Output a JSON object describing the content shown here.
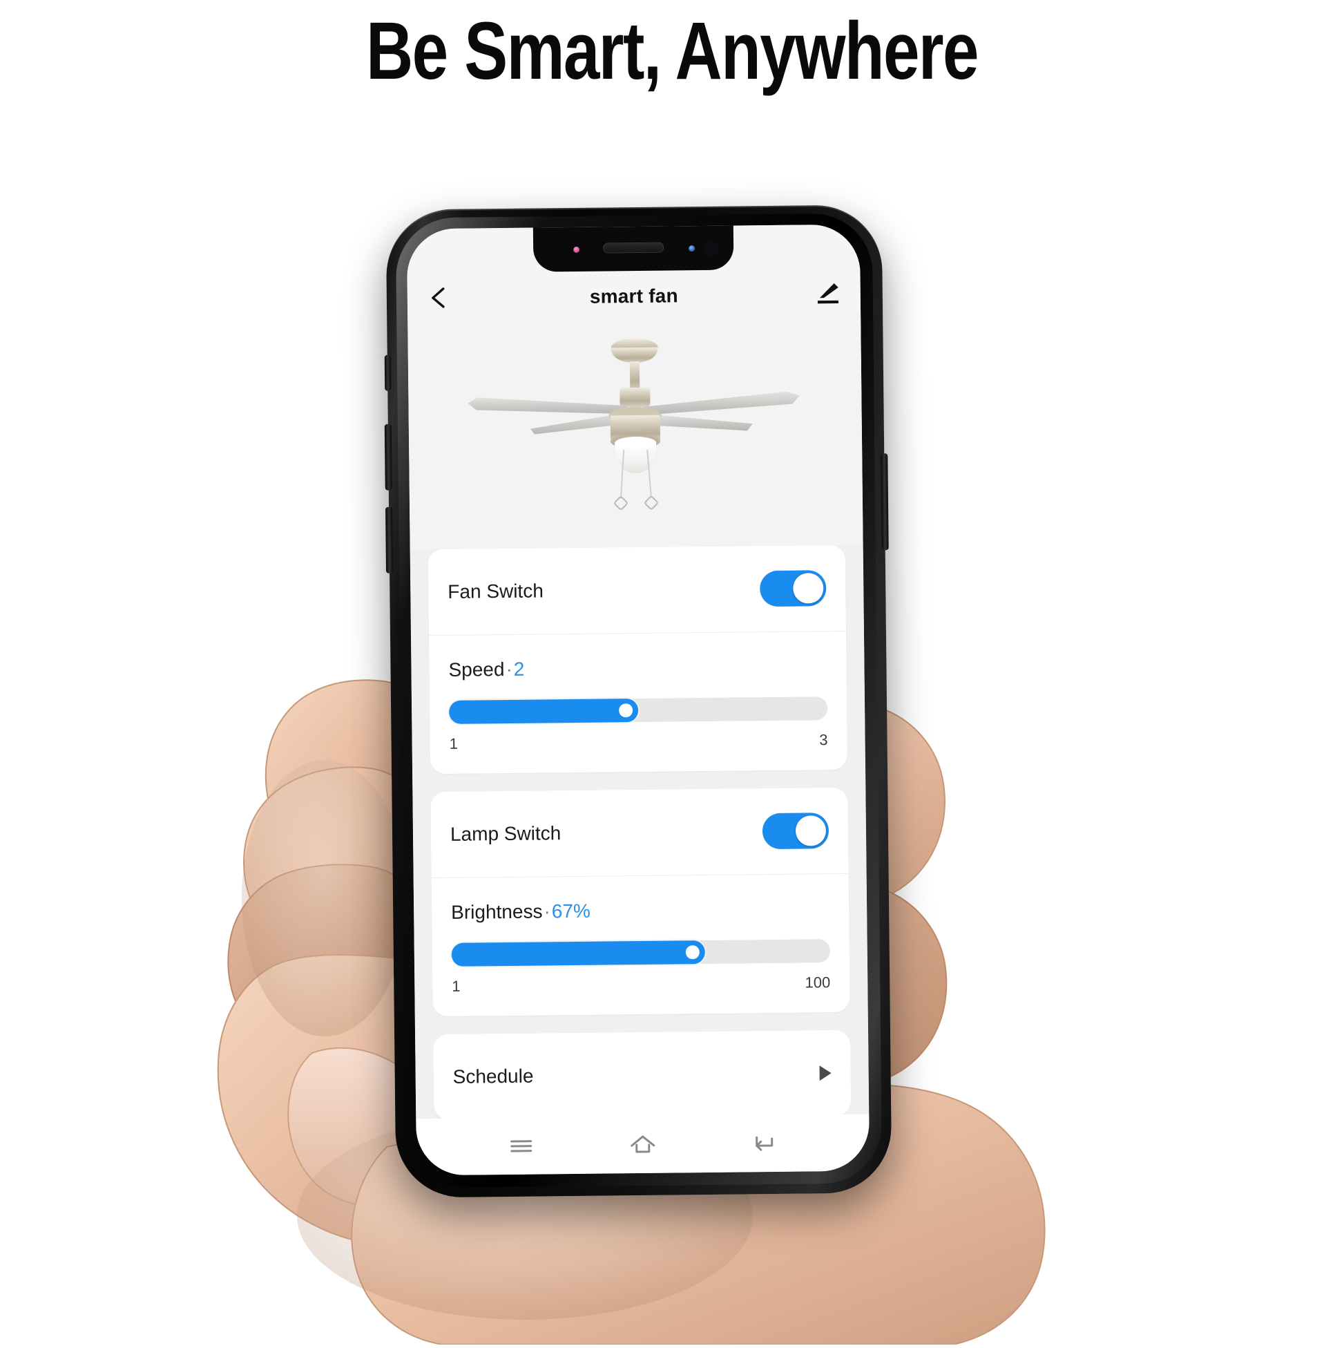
{
  "headline": "Be Smart, Anywhere",
  "phone": {
    "status_notch": {
      "speaker": "earpiece-speaker",
      "ir_sensor": "ir-sensor-dot",
      "front_camera": "front-camera-dot"
    }
  },
  "app": {
    "nav": {
      "back_icon": "chevron-left-icon",
      "title": "smart fan",
      "edit_icon": "pencil-edit-icon"
    },
    "hero": {
      "image_name": "ceiling-fan-product-image",
      "alt": "Ceiling fan with light kit"
    },
    "cards": [
      {
        "id": "fan-card",
        "switch": {
          "label": "Fan Switch",
          "state": "on"
        },
        "slider": {
          "name": "Speed",
          "separator": "·",
          "value": "2",
          "min_label": "1",
          "max_label": "3",
          "fill_percent": 50
        }
      },
      {
        "id": "lamp-card",
        "switch": {
          "label": "Lamp Switch",
          "state": "on"
        },
        "slider": {
          "name": "Brightness",
          "separator": "·",
          "value": "67%",
          "min_label": "1",
          "max_label": "100",
          "fill_percent": 67
        }
      }
    ],
    "schedule": {
      "label": "Schedule",
      "chevron_icon": "chevron-right-icon"
    },
    "android_nav": {
      "recents_icon": "menu-recents-icon",
      "home_icon": "home-icon",
      "back_icon": "back-arrow-icon"
    }
  },
  "colors": {
    "accent": "#1a8cf0",
    "accent_text": "#2a90e8",
    "track": "#e6e6e6",
    "card_bg": "#ffffff",
    "app_bg": "#f0f0f0",
    "header_bg": "#f5f5f5",
    "text": "#1b1b1b"
  }
}
